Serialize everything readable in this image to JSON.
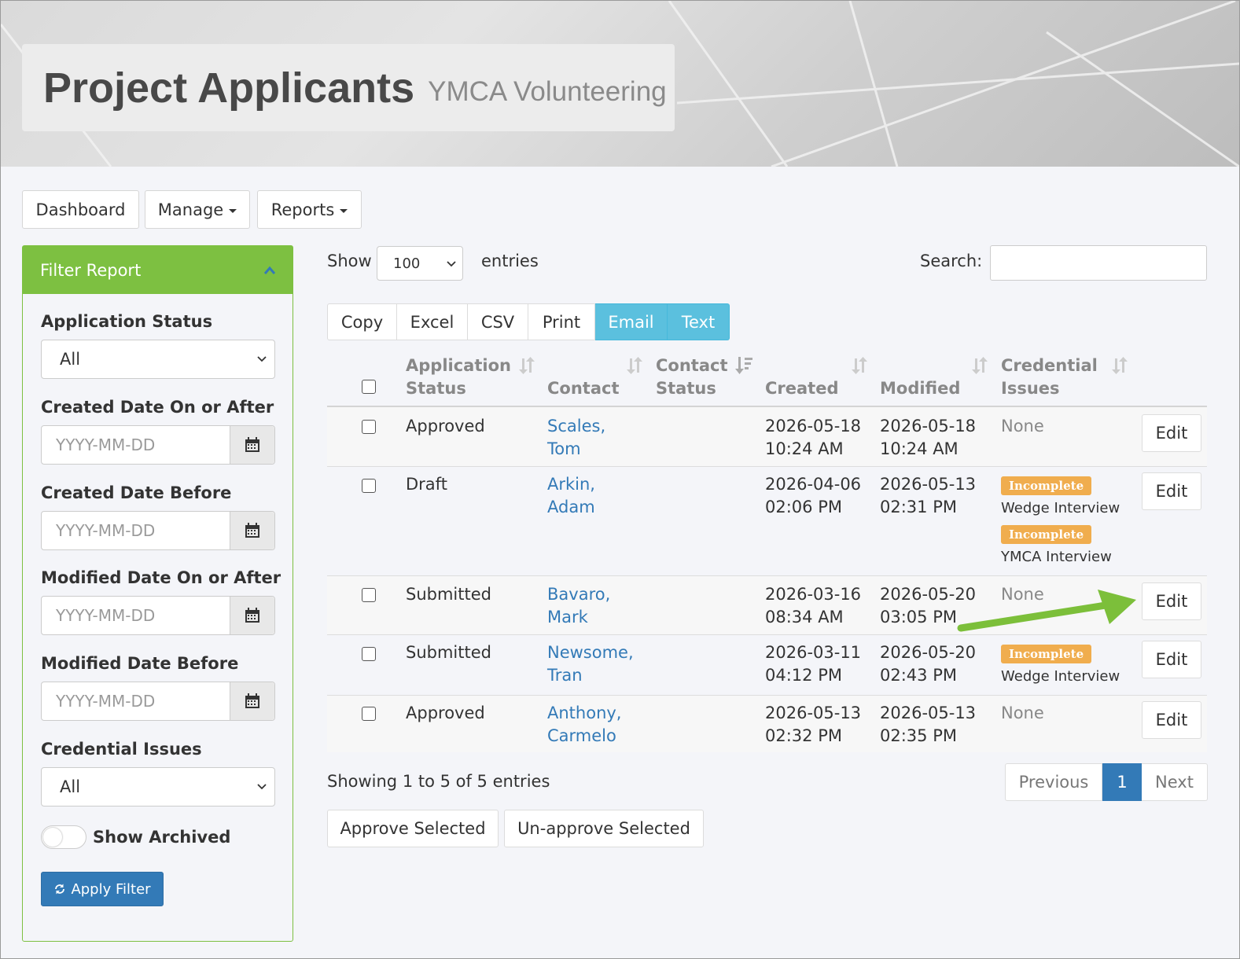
{
  "header": {
    "title": "Project Applicants",
    "subtitle": "YMCA Volunteering"
  },
  "nav": {
    "dashboard": "Dashboard",
    "manage": "Manage",
    "reports": "Reports"
  },
  "filter": {
    "title": "Filter Report",
    "application_status_label": "Application Status",
    "application_status_value": "All",
    "created_after_label": "Created Date On or After",
    "created_before_label": "Created Date Before",
    "modified_after_label": "Modified Date On or After",
    "modified_before_label": "Modified Date Before",
    "date_placeholder": "YYYY-MM-DD",
    "credential_issues_label": "Credential Issues",
    "credential_issues_value": "All",
    "show_archived_label": "Show Archived",
    "show_archived_on": false,
    "apply_label": "Apply Filter"
  },
  "controls": {
    "show_label": "Show",
    "entries_value": "100",
    "entries_label": "entries",
    "search_label": "Search:"
  },
  "export_buttons": [
    "Copy",
    "Excel",
    "CSV",
    "Print",
    "Email",
    "Text"
  ],
  "table": {
    "headers": {
      "application_status_1": "Application",
      "application_status_2": "Status",
      "contact": "Contact",
      "contact_status_1": "Contact",
      "contact_status_2": "Status",
      "created": "Created",
      "modified": "Modified",
      "credential_issues_1": "Credential",
      "credential_issues_2": "Issues"
    },
    "edit_label": "Edit",
    "rows": [
      {
        "status": "Approved",
        "contact_last": "Scales,",
        "contact_first": "Tom",
        "created_date": "2026-05-18",
        "created_time": "10:24 AM",
        "modified_date": "2026-05-18",
        "modified_time": "10:24 AM",
        "credential": "None"
      },
      {
        "status": "Draft",
        "contact_last": "Arkin,",
        "contact_first": "Adam",
        "created_date": "2026-04-06",
        "created_time": "02:06 PM",
        "modified_date": "2026-05-13",
        "modified_time": "02:31 PM",
        "badge1": "Incomplete",
        "cred1": "Wedge Interview",
        "badge2": "Incomplete",
        "cred2": "YMCA Interview"
      },
      {
        "status": "Submitted",
        "contact_last": "Bavaro,",
        "contact_first": "Mark",
        "created_date": "2026-03-16",
        "created_time": "08:34 AM",
        "modified_date": "2026-05-20",
        "modified_time": "03:05 PM",
        "credential": "None"
      },
      {
        "status": "Submitted",
        "contact_last": "Newsome,",
        "contact_first": "Tran",
        "created_date": "2026-03-11",
        "created_time": "04:12 PM",
        "modified_date": "2026-05-20",
        "modified_time": "02:43 PM",
        "badge1": "Incomplete",
        "cred1": "Wedge Interview"
      },
      {
        "status": "Approved",
        "contact_last": "Anthony,",
        "contact_first": "Carmelo",
        "created_date": "2026-05-13",
        "created_time": "02:32 PM",
        "modified_date": "2026-05-13",
        "modified_time": "02:35 PM",
        "credential": "None"
      }
    ]
  },
  "footer": {
    "info": "Showing 1 to 5 of 5 entries",
    "previous": "Previous",
    "page": "1",
    "next": "Next",
    "approve_selected": "Approve Selected",
    "unapprove_selected": "Un-approve Selected"
  },
  "colors": {
    "green": "#7dc041",
    "blue": "#337ab7",
    "info": "#5bc0de",
    "warning": "#f0ad4e",
    "arrow": "#7cbf3a"
  }
}
